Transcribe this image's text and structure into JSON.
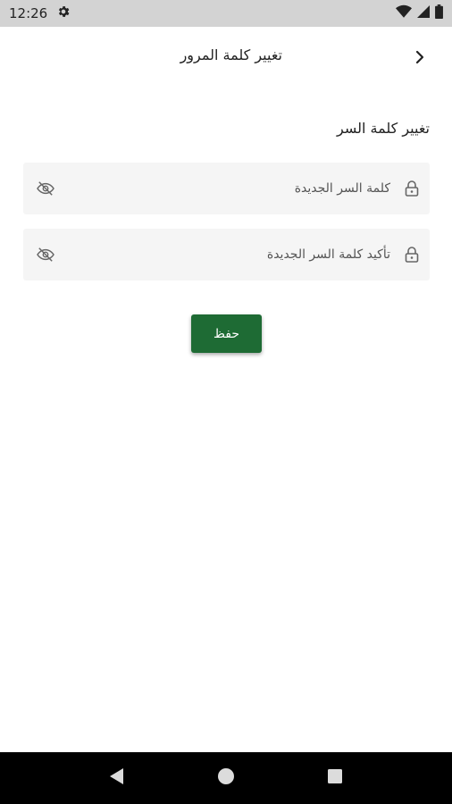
{
  "status_bar": {
    "time": "12:26",
    "icons": [
      "settings-icon",
      "wifi-icon",
      "signal-icon",
      "battery-icon"
    ]
  },
  "app_bar": {
    "title": "تغيير كلمة المرور",
    "back_icon": "chevron-right-icon"
  },
  "form": {
    "heading": "تغيير كلمة السر",
    "new_password": {
      "placeholder": "كلمة السر الجديدة",
      "value": "",
      "leading_icon": "lock-icon",
      "trailing_icon": "eye-off-icon"
    },
    "confirm_password": {
      "placeholder": "تأكيد كلمة السر الجديدة",
      "value": "",
      "leading_icon": "lock-icon",
      "trailing_icon": "eye-off-icon"
    },
    "save_label": "حفظ"
  },
  "nav_bar": {
    "buttons": [
      "back-triangle-icon",
      "home-circle-icon",
      "recents-square-icon"
    ]
  },
  "colors": {
    "accent": "#1e6b34",
    "status_bar_bg": "#d3d3d3",
    "field_bg": "#f5f5f5",
    "nav_bar_bg": "#000000"
  }
}
